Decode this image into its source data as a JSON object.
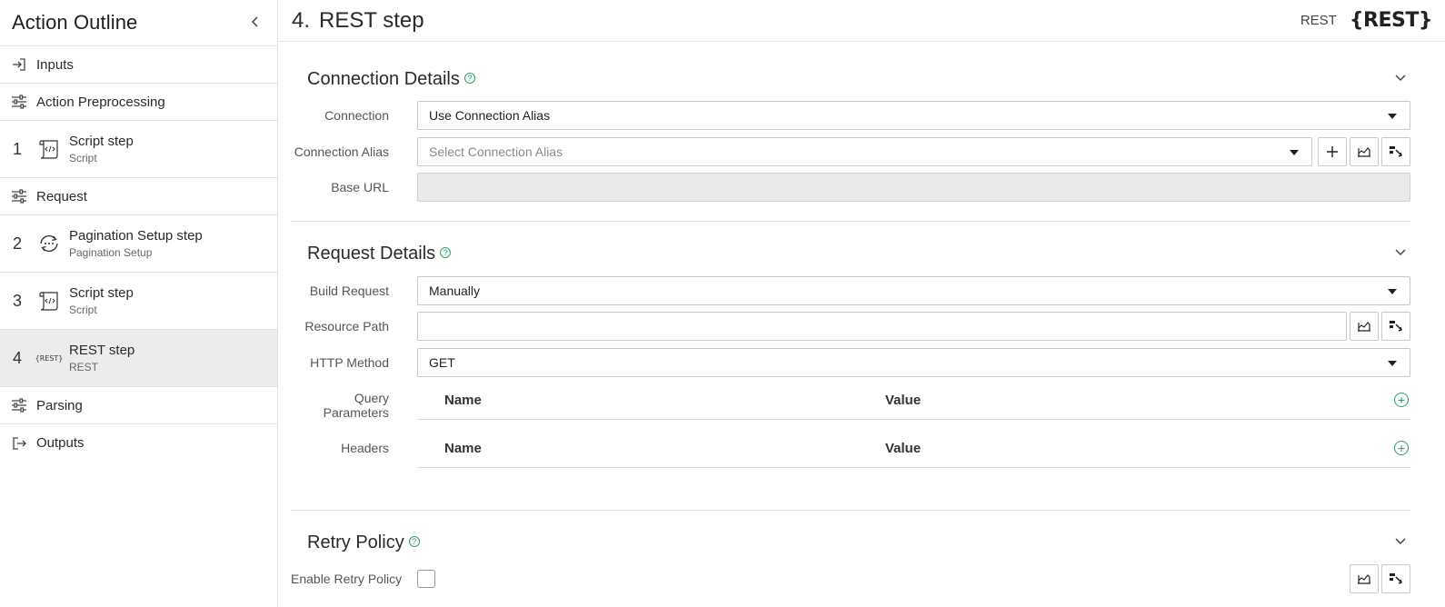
{
  "sidebar": {
    "title": "Action Outline",
    "items": [
      {
        "kind": "plain",
        "label": "Inputs",
        "icon": "sign-in-icon"
      },
      {
        "kind": "plain",
        "label": "Action Preprocessing",
        "icon": "sliders-icon"
      },
      {
        "kind": "step",
        "num": "1",
        "label": "Script step",
        "sub": "Script",
        "icon": "script-scroll-icon"
      },
      {
        "kind": "plain",
        "label": "Request",
        "icon": "sliders-icon"
      },
      {
        "kind": "step",
        "num": "2",
        "label": "Pagination Setup step",
        "sub": "Pagination Setup",
        "icon": "pagination-loop-icon"
      },
      {
        "kind": "step",
        "num": "3",
        "label": "Script step",
        "sub": "Script",
        "icon": "script-scroll-icon"
      },
      {
        "kind": "step",
        "num": "4",
        "label": "REST step",
        "sub": "REST",
        "icon": "rest-icon",
        "icon_text": "{REST}",
        "active": true
      },
      {
        "kind": "plain",
        "label": "Parsing",
        "icon": "sliders-icon"
      },
      {
        "kind": "plain",
        "label": "Outputs",
        "icon": "sign-out-icon"
      }
    ]
  },
  "header": {
    "number": "4.",
    "title": "REST step",
    "type_label": "REST",
    "logo_text": "{REST}"
  },
  "connection_details": {
    "title": "Connection Details",
    "connection": {
      "label": "Connection",
      "value": "Use Connection Alias"
    },
    "alias": {
      "label": "Connection Alias",
      "placeholder": "Select Connection Alias"
    },
    "base_url": {
      "label": "Base URL",
      "value": ""
    }
  },
  "request_details": {
    "title": "Request Details",
    "build_request": {
      "label": "Build Request",
      "value": "Manually"
    },
    "resource_path": {
      "label": "Resource Path",
      "value": ""
    },
    "http_method": {
      "label": "HTTP Method",
      "value": "GET"
    },
    "query_params": {
      "label": "Query Parameters",
      "col_name": "Name",
      "col_value": "Value"
    },
    "headers": {
      "label": "Headers",
      "col_name": "Name",
      "col_value": "Value"
    }
  },
  "retry_policy": {
    "title": "Retry Policy",
    "enable": {
      "label": "Enable Retry Policy",
      "checked": false
    }
  },
  "colors": {
    "accent_green": "#2e9d6b",
    "active_row": "#ececec",
    "disabled_field": "#e8eaeb"
  }
}
